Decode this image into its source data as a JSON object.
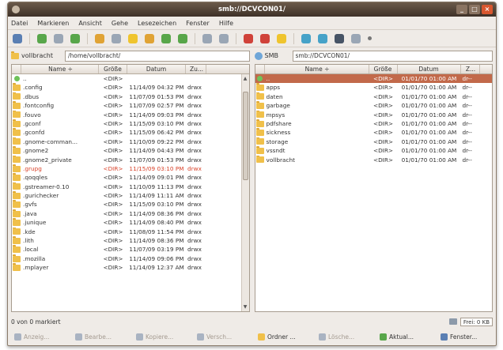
{
  "window": {
    "title": "smb://DCVCON01/"
  },
  "menu": [
    "Datei",
    "Markieren",
    "Ansicht",
    "Gehe",
    "Lesezeichen",
    "Fenster",
    "Hilfe"
  ],
  "toolbar_icons": [
    {
      "name": "terminal-icon",
      "color": "#5a7fb3"
    },
    {
      "name": "back-icon",
      "color": "#58a64a"
    },
    {
      "name": "forward-icon",
      "color": "#9aa6b5"
    },
    {
      "name": "refresh-icon",
      "color": "#58a64a"
    },
    {
      "name": "home-icon",
      "color": "#e0a335"
    },
    {
      "name": "stop-icon",
      "color": "#9aa6b5"
    },
    {
      "name": "copy-names-icon",
      "color": "#efc42e"
    },
    {
      "name": "copy-path-icon",
      "color": "#e0a335"
    },
    {
      "name": "refresh-both-icon",
      "color": "#58a64a"
    },
    {
      "name": "flip-panes-icon",
      "color": "#58a64a"
    },
    {
      "name": "search-icon",
      "color": "#9aa6b5"
    },
    {
      "name": "connect-icon",
      "color": "#9aa6b5"
    },
    {
      "name": "bookmarks-icon",
      "color": "#d0423a"
    },
    {
      "name": "favorites-icon",
      "color": "#d0423a"
    },
    {
      "name": "edit-icon",
      "color": "#efc42e"
    },
    {
      "name": "network-icon",
      "color": "#46a2c8"
    },
    {
      "name": "smb-icon",
      "color": "#46a2c8"
    },
    {
      "name": "monitor-icon",
      "color": "#475466"
    },
    {
      "name": "display-icon",
      "color": "#9aa6b5"
    },
    {
      "name": "more-icon",
      "color": "#777777"
    }
  ],
  "left_pane": {
    "label": "vollbracht",
    "path": "/home/vollbracht/",
    "columns": [
      "Name ÷",
      "Größe",
      "Datum",
      "Zu..."
    ],
    "rows": [
      {
        "name": "..",
        "size": "<DIR>",
        "date": "",
        "attr": "",
        "type": "up"
      },
      {
        "name": ".config",
        "size": "<DIR>",
        "date": "11/14/09 04:32 PM",
        "attr": "drwx"
      },
      {
        "name": ".dbus",
        "size": "<DIR>",
        "date": "11/07/09 01:53 PM",
        "attr": "drwx"
      },
      {
        "name": ".fontconfig",
        "size": "<DIR>",
        "date": "11/07/09 02:57 PM",
        "attr": "drwx"
      },
      {
        "name": ".fouvo",
        "size": "<DIR>",
        "date": "11/14/09 09:03 PM",
        "attr": "drwx"
      },
      {
        "name": ".gconf",
        "size": "<DIR>",
        "date": "11/15/09 03:10 PM",
        "attr": "drwx"
      },
      {
        "name": ".gconfd",
        "size": "<DIR>",
        "date": "11/15/09 06:42 PM",
        "attr": "drwx"
      },
      {
        "name": ".gnome-comman...",
        "size": "<DIR>",
        "date": "11/10/09 09:22 PM",
        "attr": "drwx"
      },
      {
        "name": ".gnome2",
        "size": "<DIR>",
        "date": "11/14/09 04:43 PM",
        "attr": "drwx"
      },
      {
        "name": ".gnome2_private",
        "size": "<DIR>",
        "date": "11/07/09 01:53 PM",
        "attr": "drwx"
      },
      {
        "name": ".grupg",
        "size": "<DIR>",
        "date": "11/15/09 03:10 PM",
        "attr": "drwx",
        "marked": true
      },
      {
        "name": ".qoqqles",
        "size": "<DIR>",
        "date": "11/14/09 09:01 PM",
        "attr": "drwx"
      },
      {
        "name": ".gstreamer-0.10",
        "size": "<DIR>",
        "date": "11/10/09 11:13 PM",
        "attr": "drwx"
      },
      {
        "name": ".gurichecker",
        "size": "<DIR>",
        "date": "11/14/09 11:11 AM",
        "attr": "drwx"
      },
      {
        "name": ".gvfs",
        "size": "<DIR>",
        "date": "11/15/09 03:10 PM",
        "attr": "drwx"
      },
      {
        "name": ".java",
        "size": "<DIR>",
        "date": "11/14/09 08:36 PM",
        "attr": "drwx"
      },
      {
        "name": ".junique",
        "size": "<DIR>",
        "date": "11/14/09 08:40 PM",
        "attr": "drwx"
      },
      {
        "name": ".kde",
        "size": "<DIR>",
        "date": "11/08/09 11:54 PM",
        "attr": "drwx"
      },
      {
        "name": ".lith",
        "size": "<DIR>",
        "date": "11/14/09 08:36 PM",
        "attr": "drwx"
      },
      {
        "name": ".local",
        "size": "<DIR>",
        "date": "11/07/09 03:19 PM",
        "attr": "drwx"
      },
      {
        "name": ".mozilla",
        "size": "<DIR>",
        "date": "11/14/09 09:06 PM",
        "attr": "drwx"
      },
      {
        "name": ".mplayer",
        "size": "<DIR>",
        "date": "11/14/09 12:37 AM",
        "attr": "drwx"
      }
    ]
  },
  "right_pane": {
    "label": "SMB",
    "path": "smb://DCVCON01/",
    "columns": [
      "Name ÷",
      "Größe",
      "Datum",
      "Z..."
    ],
    "rows": [
      {
        "name": "..",
        "size": "<DIR>",
        "date": "01/01/70 01:00 AM",
        "attr": "dr--",
        "type": "up",
        "selected": true
      },
      {
        "name": "apps",
        "size": "<DIR>",
        "date": "01/01/70 01:00 AM",
        "attr": "dr--"
      },
      {
        "name": "daten",
        "size": "<DIR>",
        "date": "01/01/70 01:00 AM",
        "attr": "dr--"
      },
      {
        "name": "garbage",
        "size": "<DIR>",
        "date": "01/01/70 01:00 AM",
        "attr": "dr--"
      },
      {
        "name": "mpsys",
        "size": "<DIR>",
        "date": "01/01/70 01:00 AM",
        "attr": "dr--"
      },
      {
        "name": "pdfshare",
        "size": "<DIR>",
        "date": "01/01/70 01:00 AM",
        "attr": "dr--"
      },
      {
        "name": "sickness",
        "size": "<DIR>",
        "date": "01/01/70 01:00 AM",
        "attr": "dr--"
      },
      {
        "name": "storage",
        "size": "<DIR>",
        "date": "01/01/70 01:00 AM",
        "attr": "dr--"
      },
      {
        "name": "vssndt",
        "size": "<DIR>",
        "date": "01/01/70 01:00 AM",
        "attr": "dr--"
      },
      {
        "name": "vollbracht",
        "size": "<DIR>",
        "date": "01/01/70 01:00 AM",
        "attr": "dr--"
      }
    ]
  },
  "status": {
    "left": "0 von 0 markiert",
    "free": "Frei: 0 KB"
  },
  "buttons": [
    {
      "label": "Anzeig...",
      "name": "view-button",
      "active": false,
      "color": "#a9b3c2"
    },
    {
      "label": "Bearbe...",
      "name": "edit-button",
      "active": false,
      "color": "#a9b3c2"
    },
    {
      "label": "Kopiere...",
      "name": "copy-button",
      "active": false,
      "color": "#a9b3c2"
    },
    {
      "label": "Versch...",
      "name": "move-button",
      "active": false,
      "color": "#a9b3c2"
    },
    {
      "label": "Ordner ...",
      "name": "mkdir-button",
      "active": true,
      "color": "#f0c04a"
    },
    {
      "label": "Lösche...",
      "name": "delete-button",
      "active": false,
      "color": "#a9b3c2"
    },
    {
      "label": "Aktual...",
      "name": "refresh-button",
      "active": true,
      "color": "#58a64a"
    },
    {
      "label": "Fenster...",
      "name": "window-button",
      "active": true,
      "color": "#5a7fb3"
    }
  ]
}
